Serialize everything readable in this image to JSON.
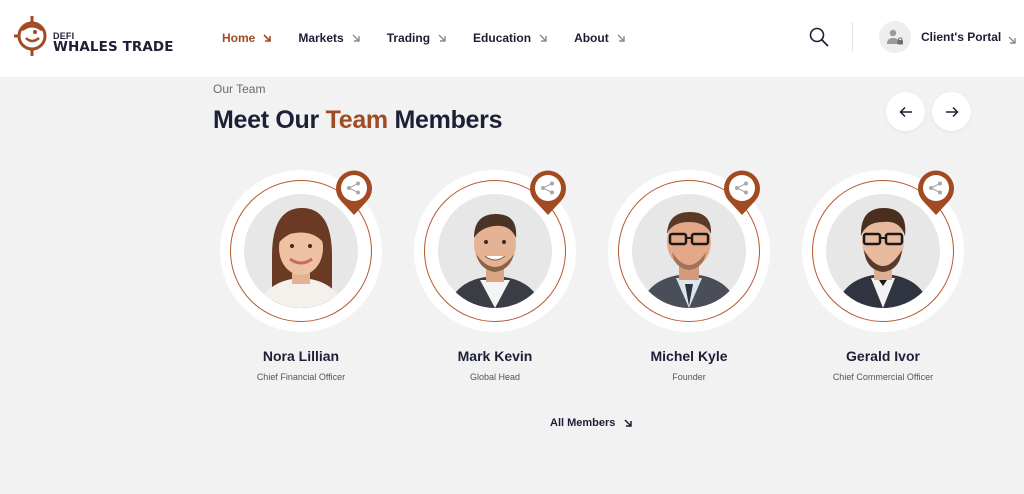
{
  "brand": {
    "small": "DEFI",
    "big": "WHALES TRADE",
    "accent_color": "#a24a22",
    "dark_color": "#1d1f36"
  },
  "nav": [
    {
      "label": "Home",
      "active": true
    },
    {
      "label": "Markets",
      "active": false
    },
    {
      "label": "Trading",
      "active": false
    },
    {
      "label": "Education",
      "active": false
    },
    {
      "label": "About",
      "active": false
    }
  ],
  "header_actions": {
    "search_icon": "search-icon",
    "portal_label": "Client's Portal",
    "portal_icon": "user-lock-icon"
  },
  "section": {
    "eyebrow": "Our Team",
    "title_prefix": "Meet Our",
    "title_accent": "Team",
    "title_suffix": "Members"
  },
  "slider": {
    "prev_icon": "arrow-left-icon",
    "next_icon": "arrow-right-icon"
  },
  "members": [
    {
      "name": "Nora Lillian",
      "role": "Chief Financial Officer"
    },
    {
      "name": "Mark Kevin",
      "role": "Global Head"
    },
    {
      "name": "Michel Kyle",
      "role": "Founder"
    },
    {
      "name": "Gerald Ivor",
      "role": "Chief Commercial Officer"
    }
  ],
  "all_members_label": "All Members"
}
